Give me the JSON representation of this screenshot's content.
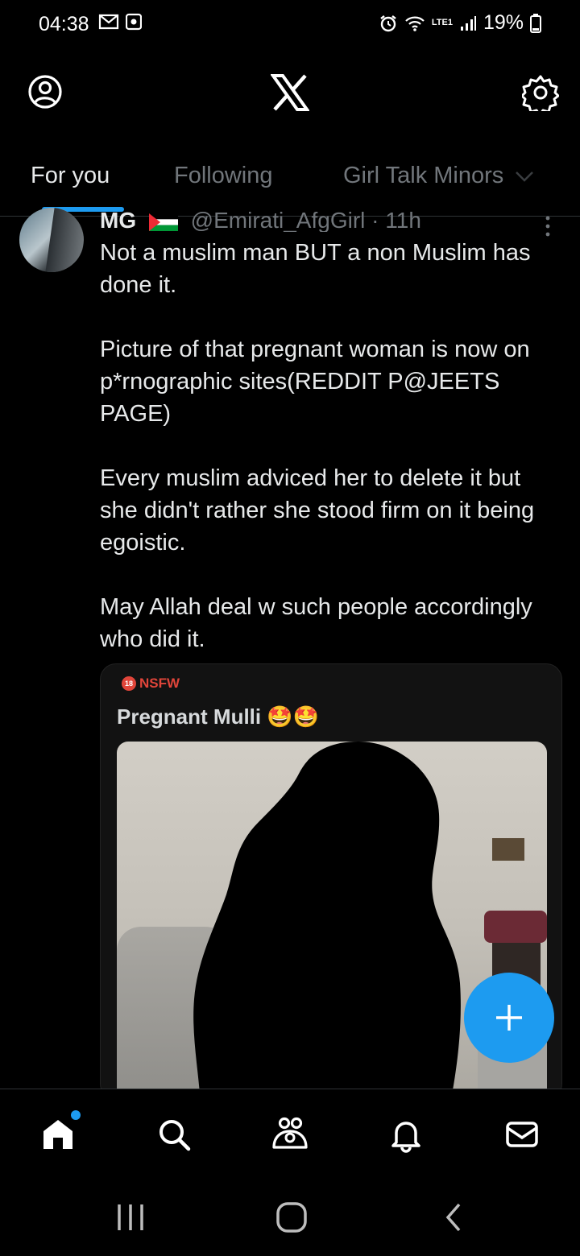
{
  "status_bar": {
    "time": "04:38",
    "battery": "19%",
    "network": "LTE1"
  },
  "header": {
    "logo": "X",
    "profile_icon": "profile-icon",
    "settings_icon": "gear-icon"
  },
  "tabs": [
    {
      "label": "For you",
      "active": true
    },
    {
      "label": "Following",
      "active": false
    },
    {
      "label": "Girl Talk Minors",
      "active": false
    }
  ],
  "tweet": {
    "display_name": "MG",
    "handle": "@Emirati_AfgGirl",
    "time": "11h",
    "text": "Not a muslim man BUT a non Muslim has done it.\n\nPicture of that pregnant woman is now on p*rnographic sites(REDDIT P@JEETS PAGE)\n\nEvery muslim adviced her to delete it but she didn't rather she stood firm on it being egoistic.\n\nMay Allah deal w such people accordingly who did it.",
    "media": {
      "nsfw_label": "NSFW",
      "nsfw_badge": "18",
      "title": "Pregnant Mulli 🤩🤩"
    }
  },
  "colors": {
    "accent": "#1d9bf0",
    "background": "#000000",
    "nsfw": "#e0453a"
  },
  "bottom_nav": [
    "home-icon",
    "search-icon",
    "communities-icon",
    "notifications-icon",
    "messages-icon"
  ],
  "system_nav": [
    "recents-icon",
    "home-circle-icon",
    "back-icon"
  ]
}
